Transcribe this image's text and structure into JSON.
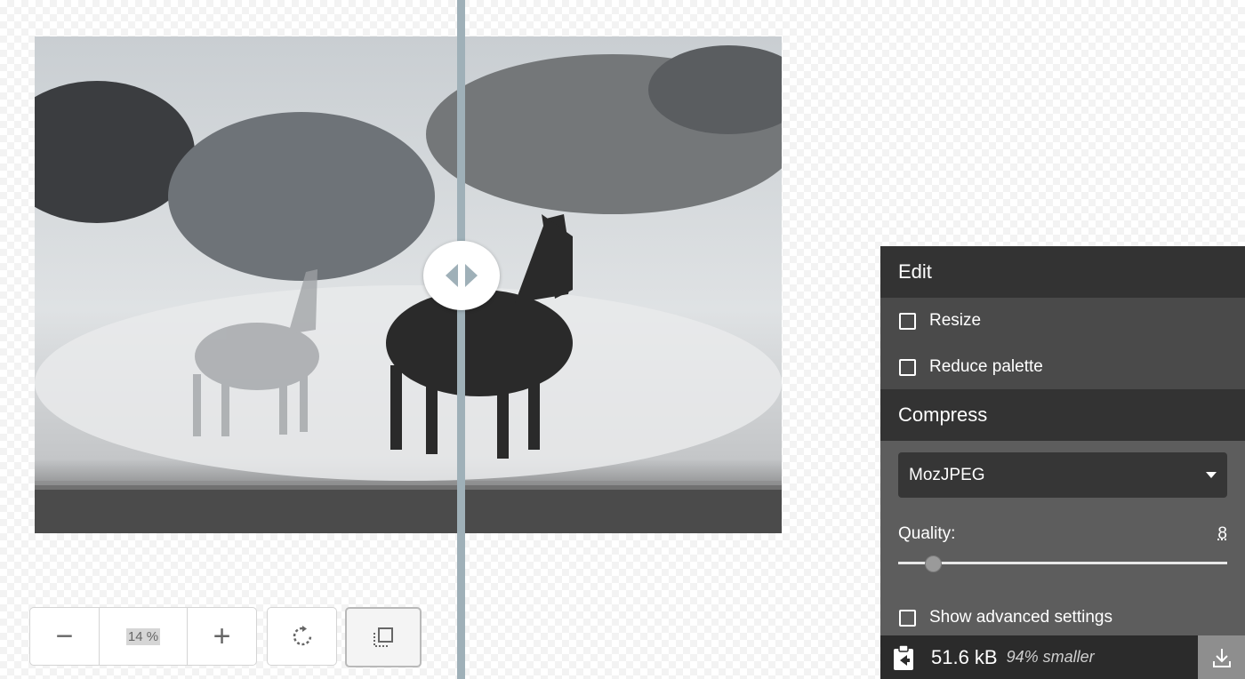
{
  "viewer": {
    "zoom": {
      "decrease_label": "−",
      "value": "14 %",
      "increase_label": "+"
    },
    "rotate_icon": "rotate-icon",
    "background_toggle_icon": "toggle-background-icon",
    "split_handle_icon": "split-handle-icon"
  },
  "panel": {
    "edit": {
      "title": "Edit",
      "options": [
        {
          "label": "Resize",
          "checked": false
        },
        {
          "label": "Reduce palette",
          "checked": false
        }
      ]
    },
    "compress": {
      "title": "Compress",
      "codec": "MozJPEG",
      "quality_label": "Quality:",
      "quality_value": "8",
      "advanced_label": "Show advanced settings"
    },
    "result": {
      "size": "51.6 kB",
      "reduction": "94% smaller",
      "copy_icon": "copy-to-side-icon",
      "download_icon": "download-icon"
    }
  }
}
